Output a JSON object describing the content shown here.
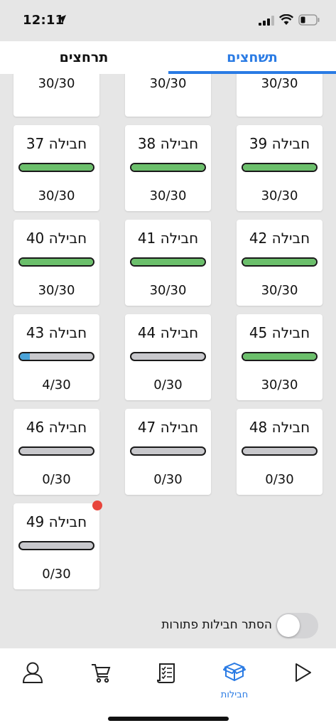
{
  "status_bar": {
    "time": "12:11"
  },
  "tabs": {
    "active": "תשחצים",
    "other": "תרחצים"
  },
  "cards": [
    {
      "title": "",
      "progress": 1.0,
      "count": "30/30",
      "color": "#6bbf6b"
    },
    {
      "title": "",
      "progress": 1.0,
      "count": "30/30",
      "color": "#6bbf6b"
    },
    {
      "title": "",
      "progress": 1.0,
      "count": "30/30",
      "color": "#6bbf6b"
    },
    {
      "title": "חבילה 37",
      "progress": 1.0,
      "count": "30/30",
      "color": "#6bbf6b"
    },
    {
      "title": "חבילה 38",
      "progress": 1.0,
      "count": "30/30",
      "color": "#6bbf6b"
    },
    {
      "title": "חבילה 39",
      "progress": 1.0,
      "count": "30/30",
      "color": "#6bbf6b"
    },
    {
      "title": "חבילה 40",
      "progress": 1.0,
      "count": "30/30",
      "color": "#6bbf6b"
    },
    {
      "title": "חבילה 41",
      "progress": 1.0,
      "count": "30/30",
      "color": "#6bbf6b"
    },
    {
      "title": "חבילה 42",
      "progress": 1.0,
      "count": "30/30",
      "color": "#6bbf6b"
    },
    {
      "title": "חבילה 43",
      "progress": 0.1333,
      "count": "4/30",
      "color": "#4aa3d8"
    },
    {
      "title": "חבילה 44",
      "progress": 0.0,
      "count": "0/30",
      "color": "#6bbf6b"
    },
    {
      "title": "חבילה 45",
      "progress": 1.0,
      "count": "30/30",
      "color": "#6bbf6b"
    },
    {
      "title": "חבילה 46",
      "progress": 0.0,
      "count": "0/30",
      "color": "#6bbf6b"
    },
    {
      "title": "חבילה 47",
      "progress": 0.0,
      "count": "0/30",
      "color": "#6bbf6b"
    },
    {
      "title": "חבילה 48",
      "progress": 0.0,
      "count": "0/30",
      "color": "#6bbf6b"
    },
    {
      "title": "חבילה 49",
      "progress": 0.0,
      "count": "0/30",
      "color": "#6bbf6b",
      "new": true
    }
  ],
  "toggle": {
    "label": "הסתר חבילות פתורות",
    "on": false
  },
  "bottom_nav": {
    "items": [
      {
        "icon": "user-icon"
      },
      {
        "icon": "cart-icon"
      },
      {
        "icon": "scroll-list-icon"
      },
      {
        "icon": "boxes-icon",
        "label": "חבילות",
        "active": true
      },
      {
        "icon": "play-icon"
      }
    ]
  }
}
